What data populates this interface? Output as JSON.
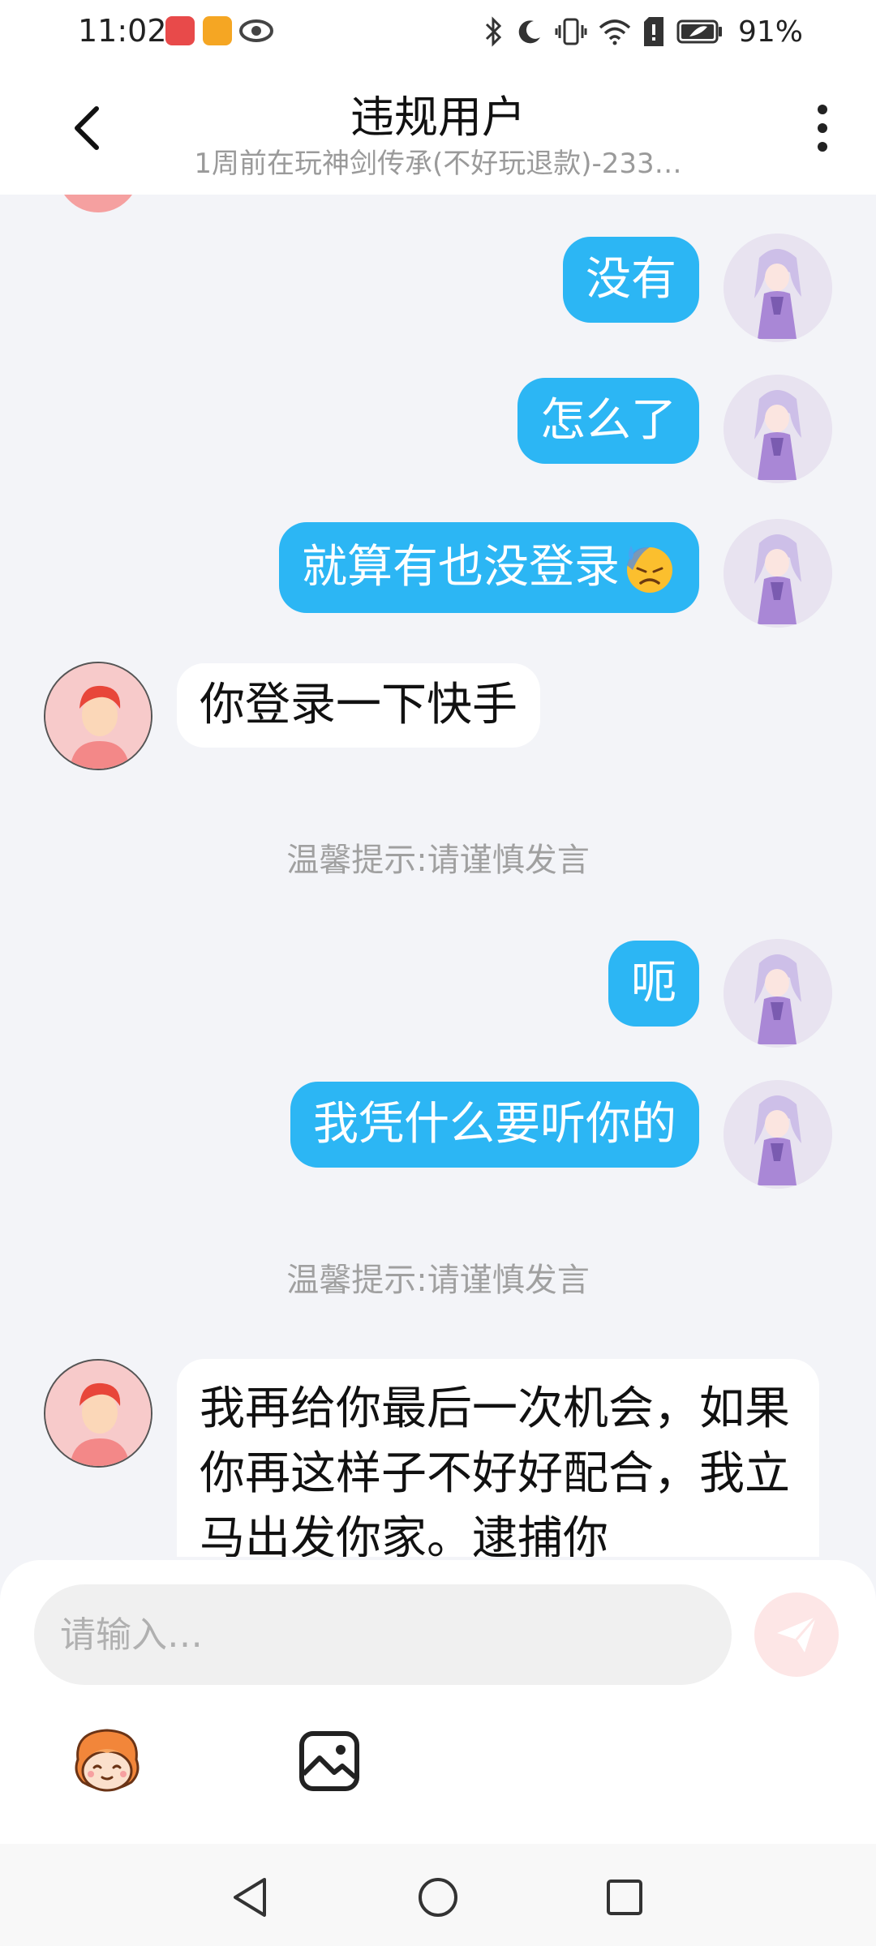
{
  "status_bar": {
    "time": "11:02",
    "battery": "91%"
  },
  "header": {
    "back_icon": "chevron-left-icon",
    "title": "违规用户",
    "subtitle": "1周前在玩神剑传承(不好玩退款)-233…",
    "more_icon": "more-vertical-icon"
  },
  "messages": [
    {
      "sender": "me",
      "text": "没有"
    },
    {
      "sender": "me",
      "text": "怎么了"
    },
    {
      "sender": "me",
      "text": "就算有也没登录",
      "emoji": "downcast-face-with-sweat"
    },
    {
      "sender": "other",
      "text": "你登录一下快手"
    },
    {
      "type": "tip",
      "text": "温馨提示:请谨慎发言"
    },
    {
      "sender": "me",
      "text": "呃"
    },
    {
      "sender": "me",
      "text": "我凭什么要听你的"
    },
    {
      "type": "tip",
      "text": "温馨提示:请谨慎发言"
    },
    {
      "sender": "other",
      "text": "我再给你最后一次机会，如果你再这样子不好好配合，我立马出发你家。逮捕你"
    }
  ],
  "input": {
    "placeholder": "请输入…",
    "send_icon": "paper-plane-icon",
    "emoji_icon": "mascot-emoji-icon",
    "image_icon": "image-icon"
  },
  "colors": {
    "outgoing_bubble": "#2cb6f4",
    "incoming_bubble": "#ffffff",
    "background": "#f3f4f8",
    "send_button": "#fde6e6"
  }
}
